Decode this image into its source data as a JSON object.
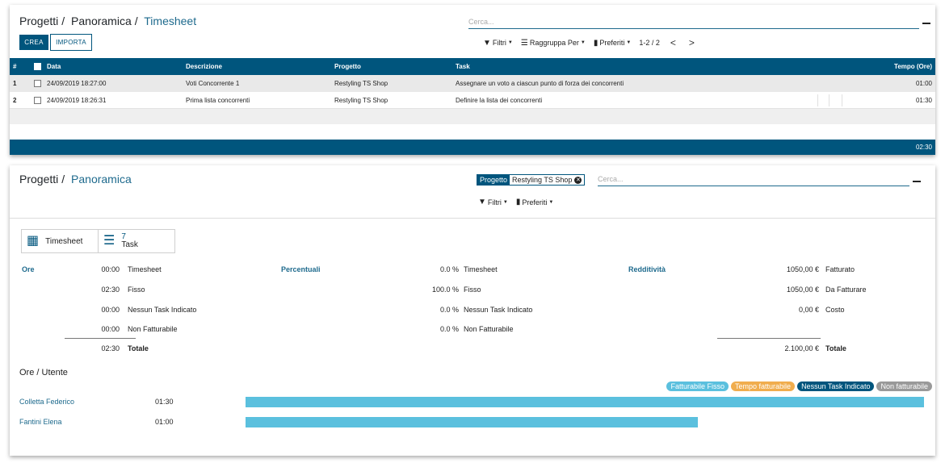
{
  "timesheet_view": {
    "breadcrumb": [
      "Progetti",
      "Panoramica",
      "Timesheet"
    ],
    "search_placeholder": "Cerca...",
    "buttons": {
      "create": "CREA",
      "import": "IMPORTA"
    },
    "filters": {
      "filters": "Filtri",
      "group_by": "Raggruppa Per",
      "favorites": "Preferiti"
    },
    "pager": {
      "value": "1-2 / 2",
      "prev": "<",
      "next": ">"
    },
    "columns": {
      "num": "#",
      "date": "Data",
      "description": "Descrizione",
      "project": "Progetto",
      "task": "Task",
      "time": "Tempo (Ore)"
    },
    "rows": [
      {
        "num": "1",
        "date": "24/09/2019 18:27:00",
        "description": "Voti Concorrente 1",
        "project": "Restyling TS Shop",
        "task": "Assegnare un voto a ciascun punto di forza dei concorrenti",
        "time": "01:00"
      },
      {
        "num": "2",
        "date": "24/09/2019 18:26:31",
        "description": "Prima lista concorrenti",
        "project": "Restyling TS Shop",
        "task": "Definire la lista dei concorrenti",
        "time": "01:30"
      }
    ],
    "total": "02:30"
  },
  "overview": {
    "breadcrumb": [
      "Progetti",
      "Panoramica"
    ],
    "facet": {
      "name": "Progetto",
      "value": "Restyling TS Shop"
    },
    "search_placeholder": "Cerca...",
    "filters": {
      "filters": "Filtri",
      "favorites": "Preferiti"
    },
    "stat_buttons": {
      "timesheet": "Timesheet",
      "task_count": "7",
      "task_label": "Task"
    },
    "hours": {
      "title": "Ore",
      "rows": [
        {
          "value": "00:00",
          "label": "Timesheet"
        },
        {
          "value": "02:30",
          "label": "Fisso"
        },
        {
          "value": "00:00",
          "label": "Nessun Task Indicato"
        },
        {
          "value": "00:00",
          "label": "Non Fatturabile"
        }
      ],
      "total_value": "02:30",
      "total_label": "Totale"
    },
    "percentages": {
      "title": "Percentuali",
      "rows": [
        {
          "value": "0.0 %",
          "label": "Timesheet"
        },
        {
          "value": "100.0 %",
          "label": "Fisso"
        },
        {
          "value": "0.0 %",
          "label": "Nessun Task Indicato"
        },
        {
          "value": "0.0 %",
          "label": "Non Fatturabile"
        }
      ]
    },
    "profitability": {
      "title": "Redditività",
      "rows": [
        {
          "value": "1050,00 €",
          "label": "Fatturato"
        },
        {
          "value": "1050,00 €",
          "label": "Da Fatturare"
        },
        {
          "value": "0,00 €",
          "label": "Costo"
        }
      ],
      "total_value": "2.100,00 €",
      "total_label": "Totale"
    },
    "users": {
      "title": "Ore / Utente",
      "legend": [
        {
          "label": "Fatturabile Fisso",
          "color": "#5bc0de"
        },
        {
          "label": "Tempo fatturabile",
          "color": "#f0ad4e"
        },
        {
          "label": "Nessun Task Indicato",
          "color": "#00557d"
        },
        {
          "label": "Non fatturabile",
          "color": "#999999"
        }
      ],
      "rows": [
        {
          "name": "Colletta Federico",
          "hours": "01:30",
          "fraction": 1.0
        },
        {
          "name": "Fantini Elena",
          "hours": "01:00",
          "fraction": 0.6667
        }
      ]
    }
  },
  "colors": {
    "primary": "#00557d",
    "link": "#1e6a8d",
    "bar": "#5bc0de"
  }
}
